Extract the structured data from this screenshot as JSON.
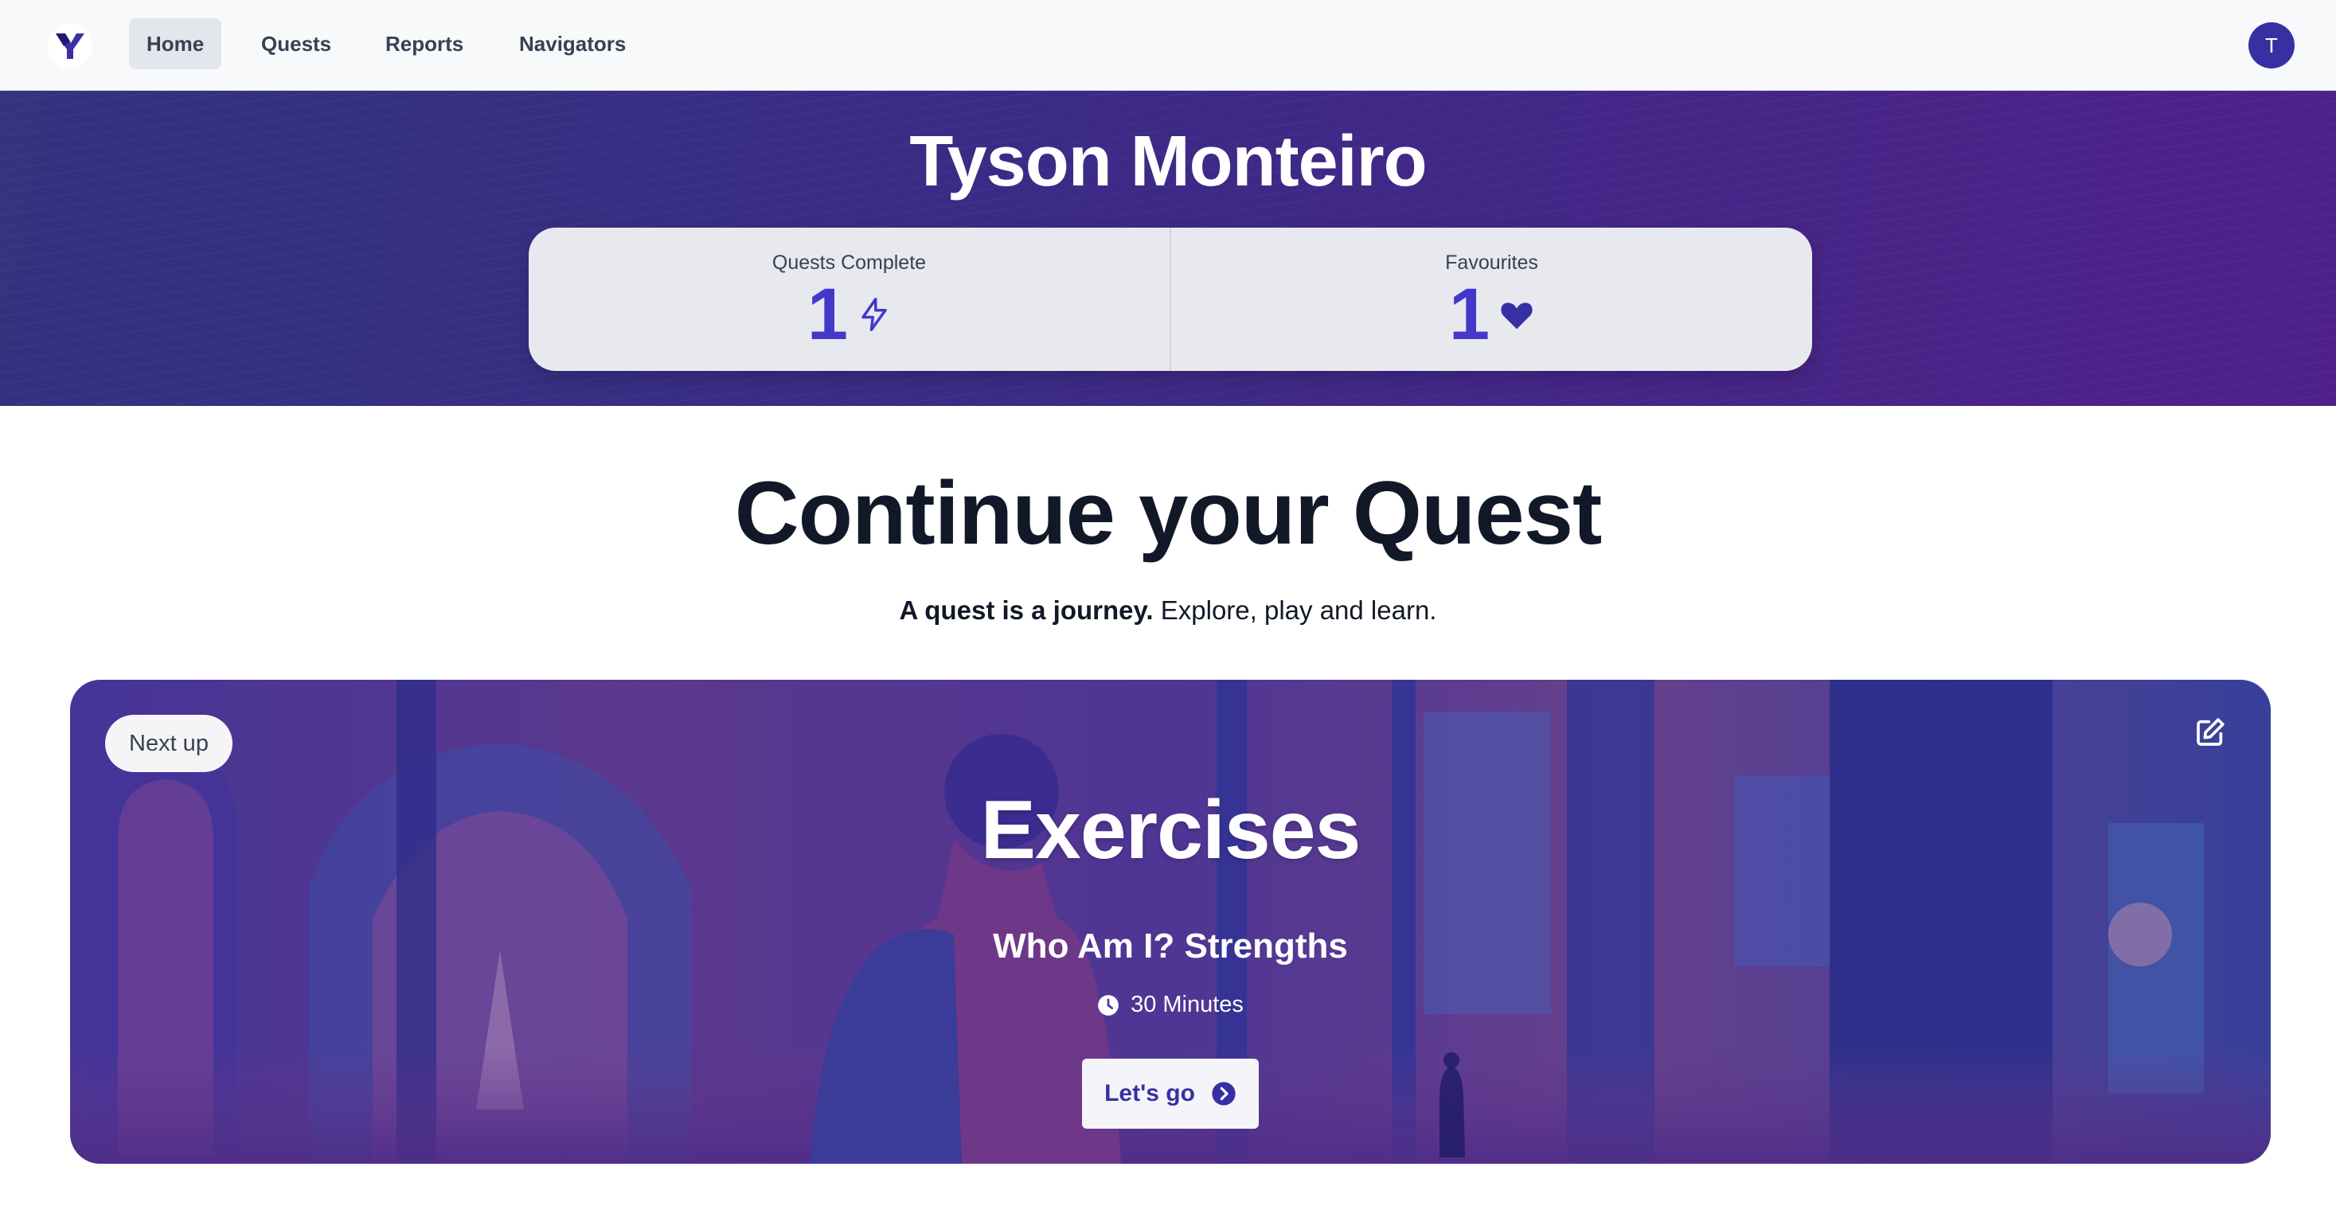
{
  "nav": {
    "items": [
      {
        "label": "Home",
        "active": true
      },
      {
        "label": "Quests",
        "active": false
      },
      {
        "label": "Reports",
        "active": false
      },
      {
        "label": "Navigators",
        "active": false
      }
    ],
    "avatar_initial": "T"
  },
  "hero": {
    "name": "Tyson Monteiro",
    "stats": [
      {
        "label": "Quests Complete",
        "value": "1",
        "icon": "lightning-icon"
      },
      {
        "label": "Favourites",
        "value": "1",
        "icon": "heart-icon"
      }
    ]
  },
  "main": {
    "title": "Continue your Quest",
    "tagline_bold": "A quest is a journey.",
    "tagline_rest": " Explore, play and learn."
  },
  "quest_card": {
    "badge": "Next up",
    "category": "Exercises",
    "name": "Who Am I? Strengths",
    "duration": "30 Minutes",
    "button_label": "Let's go"
  },
  "colors": {
    "accent": "#4338ca",
    "hero_start": "#33337f",
    "hero_end": "#4f2188"
  }
}
